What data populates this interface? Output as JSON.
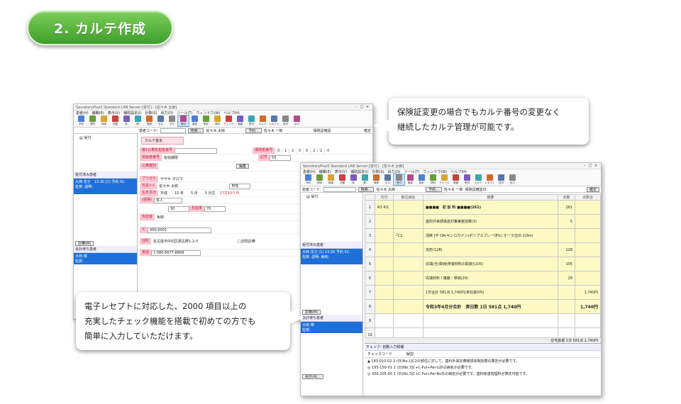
{
  "heading": "2. カルテ作成",
  "callout_top": [
    "保険証変更の場合でもカルテ番号の変更なく",
    "継続したカルテ管理が可能です。"
  ],
  "callout_bottom": [
    "電子レセプトに対応した、2000 項目以上の",
    "充実したチェック機能を搭載で初めての方でも",
    "簡単に入力していただけます。"
  ],
  "back_window": {
    "title": "SecretaryPlus5 Standard LAN Server [受付] - [佐々木 太郎]",
    "menu": [
      "患者(H)",
      "補職(E)",
      "表示(V)",
      "補助設定(I)",
      "計数(S)",
      "出力(O)",
      "ツール(T)",
      "ウィンドウ(W)",
      "ヘルプ(H)"
    ],
    "tools": [
      "予約",
      "資料",
      "検索",
      "切替",
      "改-",
      "預-",
      "登録",
      "ゼロ",
      "ゼロ",
      "受付",
      "患者",
      "統計",
      "資料",
      "チェック",
      "差額",
      "受付",
      "カルテ",
      "レセプト",
      "送付",
      "出力"
    ],
    "addr_label": "患者コード:",
    "addr_button": "検索...",
    "patient_name": "佐々木 太郎",
    "addr_button2": "予約...",
    "patient_name2": "佐々木 一郎",
    "addr_right": "保険証確認",
    "addr_end": "確定",
    "side_top": "受付",
    "side_section1": "受付済み患者",
    "side_entries1": [
      "大西 花子　13:30 [1] 予約 01:",
      "佐賀: 説明:"
    ],
    "side_section2": "会計待ち患者",
    "side_entries2": [
      "大田 博",
      "佐賀:"
    ],
    "side_btn": "診療(M)",
    "tab": "カルテ基本",
    "fields": {
      "insurer_label": "第1公費負担者番号",
      "recipient_label": "受給者番号",
      "recipient_val": "有効期限",
      "kana_label": "公費種別",
      "name_kana_label": "フリガナ",
      "name_kana": "ササキ タロウ",
      "name_label": "氏名>>",
      "name": "佐々木 太郎",
      "sex": "男性",
      "dob_label": "生年月日",
      "dob": "平成　　15 年　　5 月　　5 日生",
      "age": "17才10ケ月",
      "relation_label": "(続柄)",
      "relation": "本人",
      "zip_label": "〒",
      "zip": "450-0001",
      "address": "名古屋市中村区那古野1-2-3",
      "address_label": "住所",
      "tel_label": "電話",
      "tel": "1 080-6677-8899",
      "number_label": "保険者番号",
      "number_digits": [
        "0",
        "1",
        "2",
        "0",
        "0",
        "2",
        "2",
        "0"
      ],
      "symbol_label": "記号",
      "symbol_val": "55",
      "burden_label": "負担率",
      "burden_val": "30",
      "burden_val2": "70",
      "exempt_label": "負担金",
      "exempt_val": "免除",
      "edit_btn": "編集",
      "check_label": "□訪問診療"
    }
  },
  "front_window": {
    "title": "SecretaryPlus5 Standard LAN Server [受付] - [佐々木 太郎]",
    "menu": [
      "患者(H)",
      "補職(E)",
      "表示(V)",
      "補助設定(I)",
      "計数(S)",
      "出力(O)",
      "ツール(T)",
      "ウィンドウ(W)",
      "ヘルプ(H)"
    ],
    "tools": [
      "予約",
      "資料",
      "検索",
      "切替",
      "改-",
      "預-",
      "登録",
      "ゼロ",
      "受付",
      "患者",
      "統計",
      "資料",
      "チェック",
      "差額",
      "受付",
      "カルテ",
      "レセプト",
      "送付",
      "出力"
    ],
    "addr_label": "患者コード:",
    "addr_button": "検索...",
    "patient_name": "佐々木 太郎",
    "addr_button2": "予約...",
    "patient_name2": "佐々木 一郎",
    "addr_right": "保険証確認日:",
    "addr_end": "確定",
    "side_top": "受付",
    "side_section1": "受付済み患者",
    "side_entries1": [
      "大西 花子 (1) 13:30 予約 01:",
      "佐賀: 説明: 病気:"
    ],
    "side_btn": "診療(M)",
    "side_section2": "会計待ち患者",
    "side_entries2": [
      "大田 博",
      "佐賀:"
    ],
    "side_btn2": "会計(A)...",
    "columns": [
      "",
      "日付",
      "部位病名",
      "摘要",
      "点数",
      "点数合"
    ],
    "rows": [
      {
        "no": "1",
        "date": "R3 4/1",
        "site": "",
        "desc": "■■■■　初 診 料 ■■■■(261)",
        "pts": "261",
        "sum": ""
      },
      {
        "no": "2",
        "date": "",
        "site": "",
        "desc": "歯科外来感染症対策実施加算(5)",
        "pts": "5",
        "sum": ""
      },
      {
        "no": "3",
        "date": "",
        "site": "｢C2",
        "desc": "浸麻 [不 OA(キシロカイン)ポリプスブレー(8%) オーラ注(0.1)9ml",
        "pts": "",
        "sum": ""
      },
      {
        "no": "4",
        "date": "",
        "site": "",
        "desc": "充形(128)",
        "pts": "128",
        "sum": ""
      },
      {
        "no": "5",
        "date": "",
        "site": "",
        "desc": "充填(光)単純(修復材料の取扱)(105)",
        "pts": "105",
        "sum": ""
      },
      {
        "no": "6",
        "date": "",
        "site": "",
        "desc": "充填材料 I 複雑・単純(29)",
        "pts": "29",
        "sum": ""
      },
      {
        "no": "7",
        "date": "",
        "site": "",
        "desc": "1日合計 581点 1,740円(未収金0円)",
        "pts": "",
        "sum": "1,740円"
      },
      {
        "no": "8",
        "date": "",
        "site": "",
        "desc": "令和3年4月分合計　実日数 1日 581点 1,740円",
        "pts": "",
        "sum": "1,740円"
      },
      {
        "no": "9",
        "date": "",
        "site": "",
        "desc": "",
        "pts": "",
        "sum": ""
      },
      {
        "no": "10",
        "date": "",
        "site": "",
        "desc": "",
        "pts": "",
        "sum": ""
      },
      {
        "no": "11",
        "date": "",
        "site": "",
        "desc": "",
        "pts": "",
        "sum": ""
      }
    ],
    "status": "在宅患者 1日 581点 1,740円",
    "check_panel_title": "チェック: 自動入力候補",
    "check_headers": [
      "チェックコード",
      "解説"
    ],
    "check_rows": [
      "▲ 183-010-02  1 (日)No.1]C2の部位に対して、歯科外来診療環境体制加算の算定が必要です。",
      "◎ 195-150-01  1 (日)No.3]C+C-Pul+Per-G外の病名が必要です。",
      "◎ 200-205-00  1 (日)No.3]C+C-Pul+Per-Bo外の病名が必要です。歯科疾患管理料が算定可能です。"
    ]
  }
}
